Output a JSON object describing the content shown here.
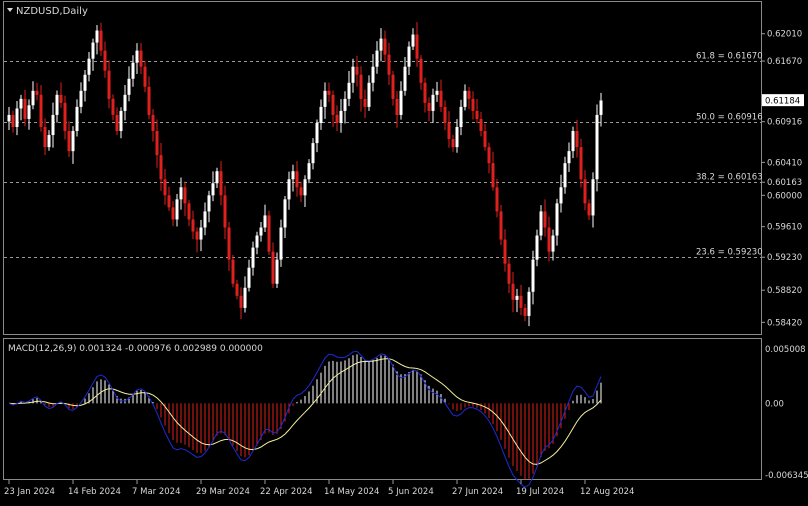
{
  "chart_data": {
    "type": "candlestick",
    "symbol": "NZDUSD,Daily",
    "colors": {
      "background": "#000000",
      "bull": "#ffffff",
      "bear": "#e0201c",
      "grid": "#9a9a9a",
      "text": "#d8d8d8",
      "macd_hist_pos": "#ffffff",
      "macd_hist_neg": "#e0201c",
      "macd_line": "#1e2bd4",
      "signal_line": "#f2ee9c"
    },
    "price_axis": {
      "range": [
        0.583,
        0.6238
      ],
      "ticks": [
        "0.62010",
        "0.61670",
        "0.61184",
        "0.60916",
        "0.60410",
        "0.60163",
        "0.60000",
        "0.59610",
        "0.59230",
        "0.58820",
        "0.58420"
      ],
      "current_price": "0.61184"
    },
    "fib_levels": [
      {
        "label": "61.8 = 0.61670",
        "price": 0.6167
      },
      {
        "label": "50.0 = 0.60916",
        "price": 0.60916
      },
      {
        "label": "38.2 = 0.60163",
        "price": 0.60163
      },
      {
        "label": "23.6 = 0.59230",
        "price": 0.5923
      }
    ],
    "date_labels": [
      {
        "label": "23 Jan 2024",
        "index": 0
      },
      {
        "label": "14 Feb 2024",
        "index": 16
      },
      {
        "label": "7 Mar 2024",
        "index": 32
      },
      {
        "label": "29 Mar 2024",
        "index": 48
      },
      {
        "label": "22 Apr 2024",
        "index": 64
      },
      {
        "label": "14 May 2024",
        "index": 80
      },
      {
        "label": "5 Jun 2024",
        "index": 96
      },
      {
        "label": "27 Jun 2024",
        "index": 112
      },
      {
        "label": "19 Jul 2024",
        "index": 128
      },
      {
        "label": "12 Aug 2024",
        "index": 144
      }
    ],
    "closes": [
      0.61,
      0.6085,
      0.6108,
      0.612,
      0.6095,
      0.6112,
      0.613,
      0.6125,
      0.6085,
      0.606,
      0.6075,
      0.61,
      0.6125,
      0.6115,
      0.608,
      0.6055,
      0.608,
      0.611,
      0.613,
      0.615,
      0.617,
      0.619,
      0.6205,
      0.618,
      0.6155,
      0.612,
      0.61,
      0.608,
      0.6105,
      0.6125,
      0.6145,
      0.6165,
      0.618,
      0.616,
      0.6135,
      0.61,
      0.608,
      0.605,
      0.602,
      0.6,
      0.5985,
      0.597,
      0.5995,
      0.601,
      0.599,
      0.597,
      0.5955,
      0.5945,
      0.596,
      0.598,
      0.6,
      0.6015,
      0.603,
      0.6,
      0.596,
      0.592,
      0.589,
      0.5875,
      0.586,
      0.5885,
      0.591,
      0.5935,
      0.595,
      0.596,
      0.5975,
      0.593,
      0.589,
      0.592,
      0.596,
      0.5995,
      0.602,
      0.603,
      0.601,
      0.6,
      0.602,
      0.604,
      0.6065,
      0.609,
      0.611,
      0.613,
      0.6125,
      0.61,
      0.609,
      0.6105,
      0.612,
      0.614,
      0.616,
      0.615,
      0.612,
      0.611,
      0.614,
      0.616,
      0.618,
      0.6195,
      0.6175,
      0.615,
      0.612,
      0.61,
      0.613,
      0.616,
      0.6185,
      0.62,
      0.617,
      0.614,
      0.6115,
      0.6105,
      0.6125,
      0.613,
      0.611,
      0.609,
      0.607,
      0.606,
      0.6085,
      0.611,
      0.613,
      0.612,
      0.6105,
      0.6095,
      0.608,
      0.606,
      0.604,
      0.601,
      0.598,
      0.5945,
      0.5915,
      0.589,
      0.587,
      0.5875,
      0.586,
      0.585,
      0.588,
      0.592,
      0.595,
      0.598,
      0.596,
      0.593,
      0.595,
      0.599,
      0.601,
      0.604,
      0.6055,
      0.608,
      0.606,
      0.602,
      0.599,
      0.5975,
      0.602,
      0.61,
      0.6118
    ],
    "macd": {
      "label": "MACD(12,26,9) 0.001324 -0.000976 0.002989 0.000000",
      "ticks": [
        "0.005008",
        "0.00",
        "-0.006345"
      ],
      "range": [
        -0.006345,
        0.005008
      ]
    }
  }
}
